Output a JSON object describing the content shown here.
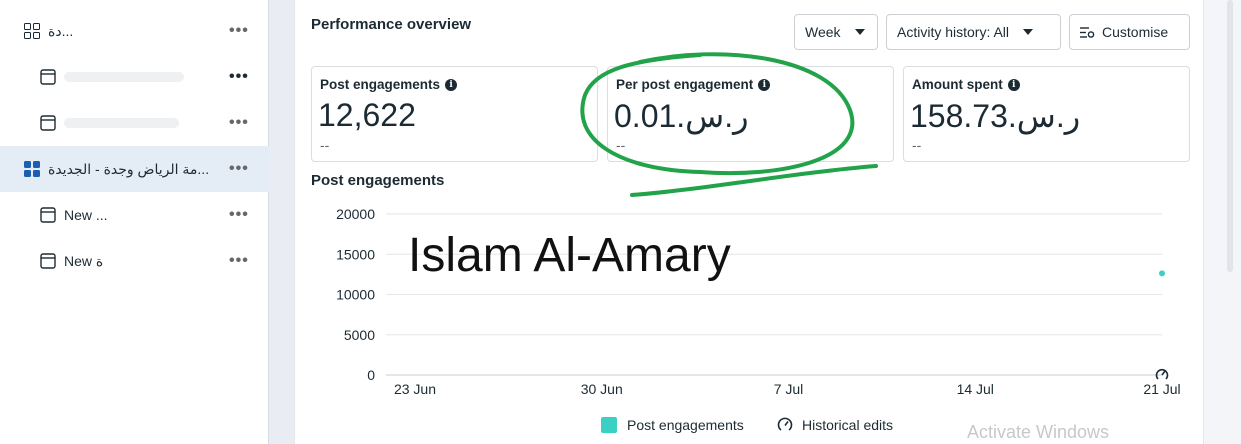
{
  "sidebar": {
    "items": [
      {
        "label": "دة..."
      },
      {
        "label": ""
      },
      {
        "label": ""
      },
      {
        "label": "...مة الرياض وجدة - الجديدة"
      },
      {
        "label": "New ..."
      },
      {
        "label": "New ة"
      }
    ],
    "more_label": "•••"
  },
  "overview": {
    "title": "Performance overview",
    "week_label": "Week",
    "activity_label": "Activity history: All",
    "customise_label": "Customise"
  },
  "metrics": [
    {
      "label": "Post engagements",
      "value": "12,622",
      "sub": "--"
    },
    {
      "label": "Per post engagement",
      "value": "0.01.ر.س",
      "sub": "--"
    },
    {
      "label": "Amount spent",
      "value": "158.73.ر.س",
      "sub": "--"
    }
  ],
  "chart_data": {
    "type": "line",
    "title": "Post engagements",
    "x": [
      "23 Jun",
      "30 Jun",
      "7 Jul",
      "14 Jul",
      "21 Jul"
    ],
    "yticks": [
      "20000",
      "15000",
      "10000",
      "5000",
      "0"
    ],
    "ylim": [
      0,
      20000
    ],
    "series": [
      {
        "name": "Post engagements",
        "color": "#3bcfc6",
        "points": [
          {
            "x": "21 Jul",
            "y": 12622
          }
        ]
      }
    ],
    "historical_edit_marker": {
      "x": "21 Jul"
    },
    "legend": [
      "Post engagements",
      "Historical edits"
    ],
    "legend_position": "bottom"
  },
  "overlay": {
    "name_text": "Islam Al-Amary",
    "activate_text": "Activate Windows",
    "circle_color": "#22a34a"
  }
}
